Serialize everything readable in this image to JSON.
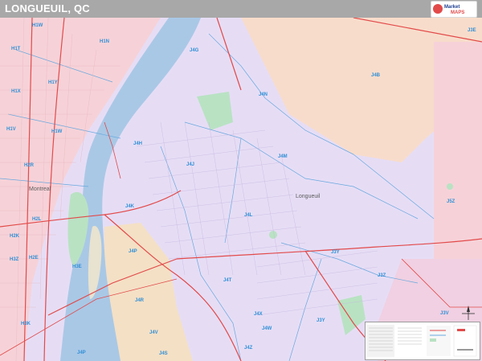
{
  "title": "LONGUEUIL, QC",
  "logo": {
    "line1": "Market",
    "line2": "MAPS",
    "icon": "market-maps-logo"
  },
  "colors": {
    "water": "#a9c8e6",
    "zone_lavender": "#e6ddf5",
    "zone_pink": "#f6d2d8",
    "zone_peach": "#f8dccb",
    "zone_tan": "#f4e0c5",
    "park_green": "#b9e2c3",
    "label_blue": "#2f8fd6",
    "road_red": "#e24a4a",
    "boundary_blue": "#6aa8de"
  },
  "map": {
    "city_labels": [
      {
        "id": "longueuil",
        "text": "Longueuil"
      },
      {
        "id": "montreal",
        "text": "Montreal"
      }
    ],
    "zone_labels": [
      {
        "id": "h1w",
        "text": "H1W"
      },
      {
        "id": "h1n",
        "text": "H1N"
      },
      {
        "id": "h1t",
        "text": "H1T"
      },
      {
        "id": "h1x",
        "text": "H1X"
      },
      {
        "id": "h1y",
        "text": "H1Y"
      },
      {
        "id": "h1v",
        "text": "H1V"
      },
      {
        "id": "h1w2",
        "text": "H1W"
      },
      {
        "id": "h2r",
        "text": "H2R"
      },
      {
        "id": "h2l",
        "text": "H2L"
      },
      {
        "id": "h2k",
        "text": "H2K"
      },
      {
        "id": "h3z",
        "text": "H3Z"
      },
      {
        "id": "h2e",
        "text": "H2E"
      },
      {
        "id": "h3k",
        "text": "H3K"
      },
      {
        "id": "j4g",
        "text": "J4G"
      },
      {
        "id": "j4n",
        "text": "J4N"
      },
      {
        "id": "j4b",
        "text": "J4B"
      },
      {
        "id": "j4h",
        "text": "J4H"
      },
      {
        "id": "j4j",
        "text": "J4J"
      },
      {
        "id": "j4m",
        "text": "J4M"
      },
      {
        "id": "j4k",
        "text": "J4K"
      },
      {
        "id": "j4l",
        "text": "J4L"
      },
      {
        "id": "j4p",
        "text": "J4P"
      },
      {
        "id": "j4r",
        "text": "J4R"
      },
      {
        "id": "j4t",
        "text": "J4T"
      },
      {
        "id": "j4v",
        "text": "J4V"
      },
      {
        "id": "j4s",
        "text": "J4S"
      },
      {
        "id": "j4x",
        "text": "J4X"
      },
      {
        "id": "j4w",
        "text": "J4W"
      },
      {
        "id": "j4z",
        "text": "J4Z"
      },
      {
        "id": "j3y",
        "text": "J3Y"
      },
      {
        "id": "j3z",
        "text": "J3Z"
      },
      {
        "id": "j5z",
        "text": "J5Z"
      },
      {
        "id": "j3v",
        "text": "J3V"
      },
      {
        "id": "j3e",
        "text": "J3E"
      },
      {
        "id": "h3e",
        "text": "H3E"
      },
      {
        "id": "j4p2",
        "text": "J4P"
      },
      {
        "id": "j3y2",
        "text": "J3Y"
      }
    ]
  }
}
